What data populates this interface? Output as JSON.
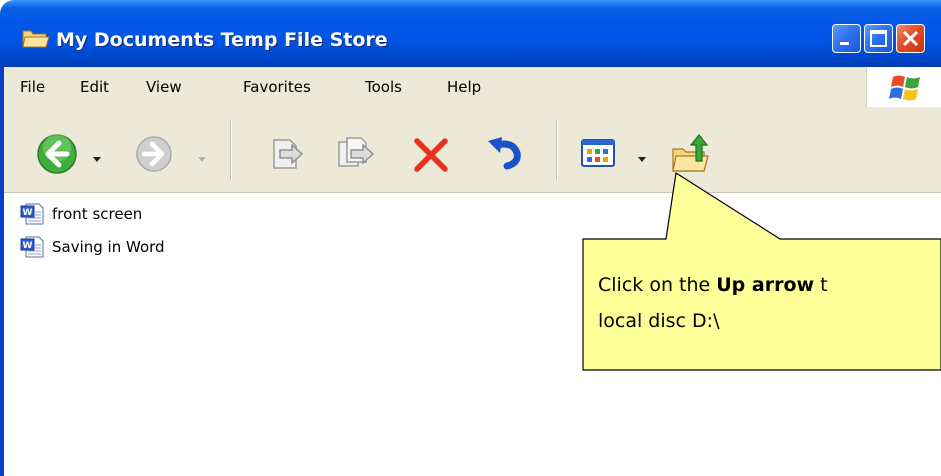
{
  "window": {
    "title": "My Documents Temp File Store"
  },
  "menu": {
    "items": [
      "File",
      "Edit",
      "View",
      "Favorites",
      "Tools",
      "Help"
    ]
  },
  "files": [
    {
      "name": "front screen"
    },
    {
      "name": "Saving in Word"
    }
  ],
  "callout": {
    "text_before": "Click on the ",
    "text_bold": "Up arrow",
    "text_after": " t",
    "line2": "local disc D:\\"
  },
  "colors": {
    "titlebar": "#0055e5",
    "menubar": "#ece9d8",
    "callout_fill": "#ffff99",
    "delete_x": "#e8321b"
  },
  "icons": {
    "title": "folder-icon",
    "back": "back-arrow-icon",
    "forward": "forward-arrow-icon",
    "move_to": "move-to-icon",
    "copy_to": "copy-to-icon",
    "delete": "delete-icon",
    "undo": "undo-icon",
    "views": "views-icon",
    "up": "folder-up-icon",
    "file": "word-document-icon",
    "windows_logo": "windows-logo-icon"
  }
}
